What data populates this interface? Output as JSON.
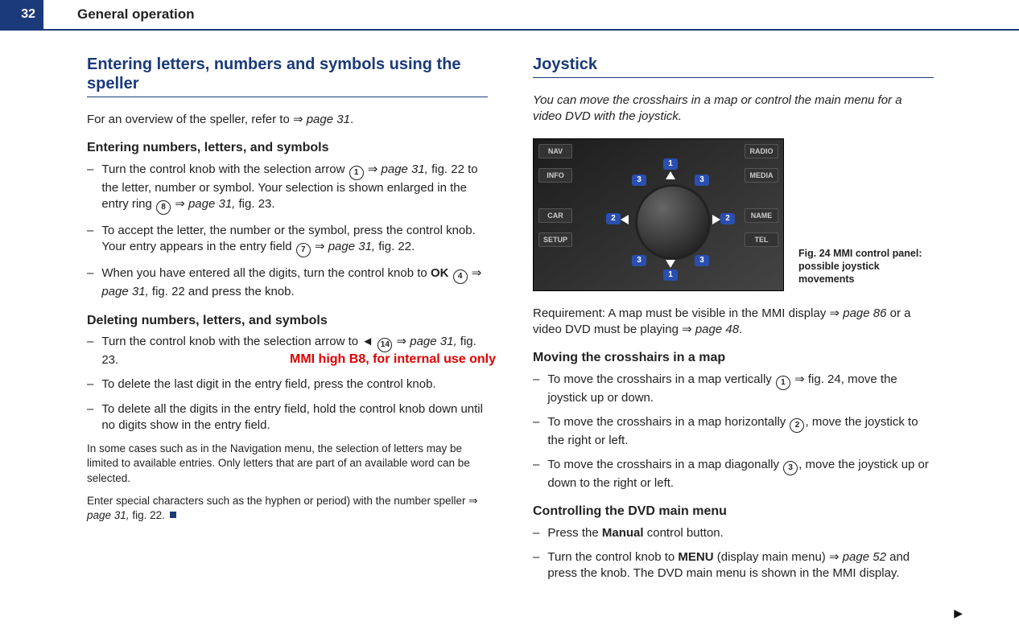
{
  "page_number": "32",
  "header_title": "General operation",
  "left": {
    "title": "Entering letters, numbers and symbols using the speller",
    "intro_a": "For an overview of the speller, refer to ",
    "intro_b": "page 31",
    "intro_c": ".",
    "sub1": "Entering numbers, letters, and symbols",
    "li1a": "Turn the control knob with the selection arrow ",
    "li1b": "page 31,",
    "li1c": " fig. 22 to the letter, number or symbol. Your selection is shown enlarged in the entry ring ",
    "li1d": "page 31,",
    "li1e": " fig. 23.",
    "li2a": "To accept the letter, the number or the symbol, press the control knob. Your entry appears in the entry field ",
    "li2b": "page 31,",
    "li2c": " fig. 22.",
    "li3a": "When you have entered all the digits, turn the control knob to ",
    "li3b": "OK",
    "li3c": "page 31,",
    "li3d": " fig. 22 and press the knob.",
    "sub2": "Deleting numbers, letters, and symbols",
    "li4a": "Turn the control knob with the selection arrow to ",
    "li4b": "page 31,",
    "li4c": " fig. 23.",
    "li5": "To delete the last digit in the entry field, press the control knob.",
    "li6": "To delete all the digits in the entry field, hold the control knob down until no digits show in the entry field.",
    "note1": "In some cases such as in the Navigation menu, the selection of letters may be limited to available entries. Only letters that are part of an available word can be selected.",
    "note2a": "Enter special characters such as the hyphen or period) with the number speller ",
    "note2b": "page 31,",
    "note2c": " fig. 22.",
    "c1": "1",
    "c8": "8",
    "c7": "7",
    "c4": "4",
    "c14": "14"
  },
  "right": {
    "title": "Joystick",
    "lead": "You can move the crosshairs in a map or control the main menu for a video DVD with the joystick.",
    "fig_caption": "Fig. 24   MMI control panel: possible joystick movements",
    "btn": {
      "nav": "NAV",
      "info": "INFO",
      "car": "CAR",
      "setup": "SETUP",
      "radio": "RADIO",
      "media": "MEDIA",
      "name": "NAME",
      "tel": "TEL"
    },
    "bub": {
      "b1": "1",
      "b2": "2",
      "b3": "3"
    },
    "req_a": "Requirement: A map must be visible in the MMI display ",
    "req_b": "page 86",
    "req_c": " or a video DVD must be playing ",
    "req_d": "page 48",
    "req_e": ".",
    "sub1": "Moving the crosshairs in a map",
    "m1a": "To move the crosshairs in a map vertically ",
    "m1b": " fig. 24, move the joystick up or down.",
    "m2a": "To move the crosshairs in a map horizontally ",
    "m2b": ", move the joystick to the right or left.",
    "m3a": "To move the crosshairs in a map diagonally ",
    "m3b": ", move the joystick up or down to the right or left.",
    "sub2": "Controlling the DVD main menu",
    "d1a": "Press the ",
    "d1b": "Manual",
    "d1c": " control button.",
    "d2a": "Turn the control knob to ",
    "d2b": "MENU",
    "d2c": " (display main menu) ",
    "d2d": "page 52",
    "d2e": " and press the knob. The DVD main menu is shown in the MMI display.",
    "c1": "1",
    "c2": "2",
    "c3": "3"
  },
  "watermark": "MMI high B8, for internal use only"
}
